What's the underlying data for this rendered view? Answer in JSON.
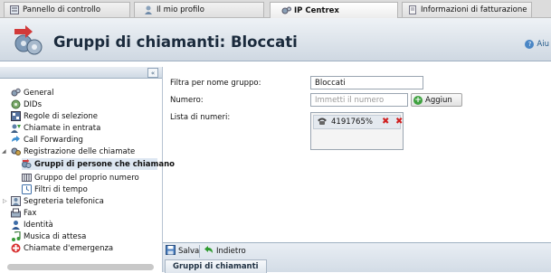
{
  "tabs": [
    {
      "label": "Pannello di controllo",
      "icon": "control-panel-icon"
    },
    {
      "label": "Il mio profilo",
      "icon": "user-icon"
    },
    {
      "label": "IP Centrex",
      "icon": "gears-icon",
      "active": true
    },
    {
      "label": "Informazioni di fatturazione",
      "icon": "billing-icon"
    }
  ],
  "header": {
    "title": "Gruppi di chiamanti: Bloccati",
    "help_label": "Aiu"
  },
  "sidebar": {
    "collapse_label": "«",
    "items": [
      {
        "label": "General",
        "icon": "gears-icon"
      },
      {
        "label": "DIDs",
        "icon": "dids-icon"
      },
      {
        "label": "Regole di selezione",
        "icon": "rules-icon"
      },
      {
        "label": "Chiamate in entrata",
        "icon": "incoming-calls-icon"
      },
      {
        "label": "Call Forwarding",
        "icon": "forward-icon"
      },
      {
        "label": "Registrazione delle chiamate",
        "icon": "recording-icon",
        "expanded": true
      },
      {
        "label": "Gruppi di persone che chiamano",
        "icon": "caller-groups-icon",
        "selected": true
      },
      {
        "label": "Gruppo del proprio numero",
        "icon": "number-group-icon"
      },
      {
        "label": "Filtri di tempo",
        "icon": "time-filter-icon"
      },
      {
        "label": "Segreteria telefonica",
        "icon": "voicemail-icon",
        "collapsed": true
      },
      {
        "label": "Fax",
        "icon": "fax-icon"
      },
      {
        "label": "Identità",
        "icon": "identity-icon"
      },
      {
        "label": "Musica di attesa",
        "icon": "music-icon"
      },
      {
        "label": "Chiamate d'emergenza",
        "icon": "emergency-icon"
      }
    ]
  },
  "form": {
    "filter_label": "Filtra per nome gruppo:",
    "filter_value": "Bloccati",
    "number_label": "Numero:",
    "number_placeholder": "Immetti il numero",
    "add_label": "Aggiun",
    "list_label": "Lista di numeri:",
    "numbers": [
      "4191765%"
    ]
  },
  "footer": {
    "save_label": "Salva",
    "back_label": "Indietro",
    "panel_tab": "Gruppi di chiamanti"
  }
}
